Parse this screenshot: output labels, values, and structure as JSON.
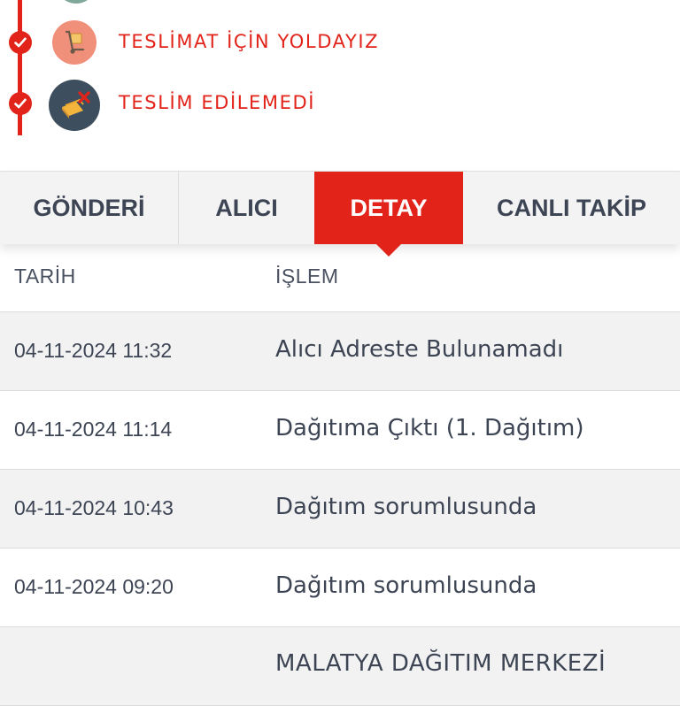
{
  "timeline": {
    "steps": [
      {
        "label": "TESLİMAT İÇİN YOLDAYIZ",
        "icon": "hand-truck-icon",
        "status": "done"
      },
      {
        "label": "TESLİM EDİLEMEDİ",
        "icon": "failed-package-icon",
        "status": "done"
      }
    ]
  },
  "tabs": [
    {
      "label": "GÖNDERİ",
      "active": false
    },
    {
      "label": "ALICI",
      "active": false
    },
    {
      "label": "DETAY",
      "active": true
    },
    {
      "label": "CANLI TAKİP",
      "active": false
    }
  ],
  "table": {
    "headers": {
      "date": "TARİH",
      "operation": "İŞLEM"
    },
    "rows": [
      {
        "date": "04-11-2024 11:32",
        "operation": "Alıcı Adreste Bulunamadı"
      },
      {
        "date": "04-11-2024 11:14",
        "operation": "Dağıtıma Çıktı (1. Dağıtım)"
      },
      {
        "date": "04-11-2024 10:43",
        "operation": "Dağıtım sorumlusunda"
      },
      {
        "date": "04-11-2024 09:20",
        "operation": "Dağıtım sorumlusunda"
      },
      {
        "date": "",
        "operation": "MALATYA DAĞITIM MERKEZİ"
      }
    ]
  },
  "colors": {
    "accent": "#e2231a",
    "text": "#3d4554",
    "tab_bg": "#f3f3f4",
    "row_alt": "#f2f2f3"
  }
}
